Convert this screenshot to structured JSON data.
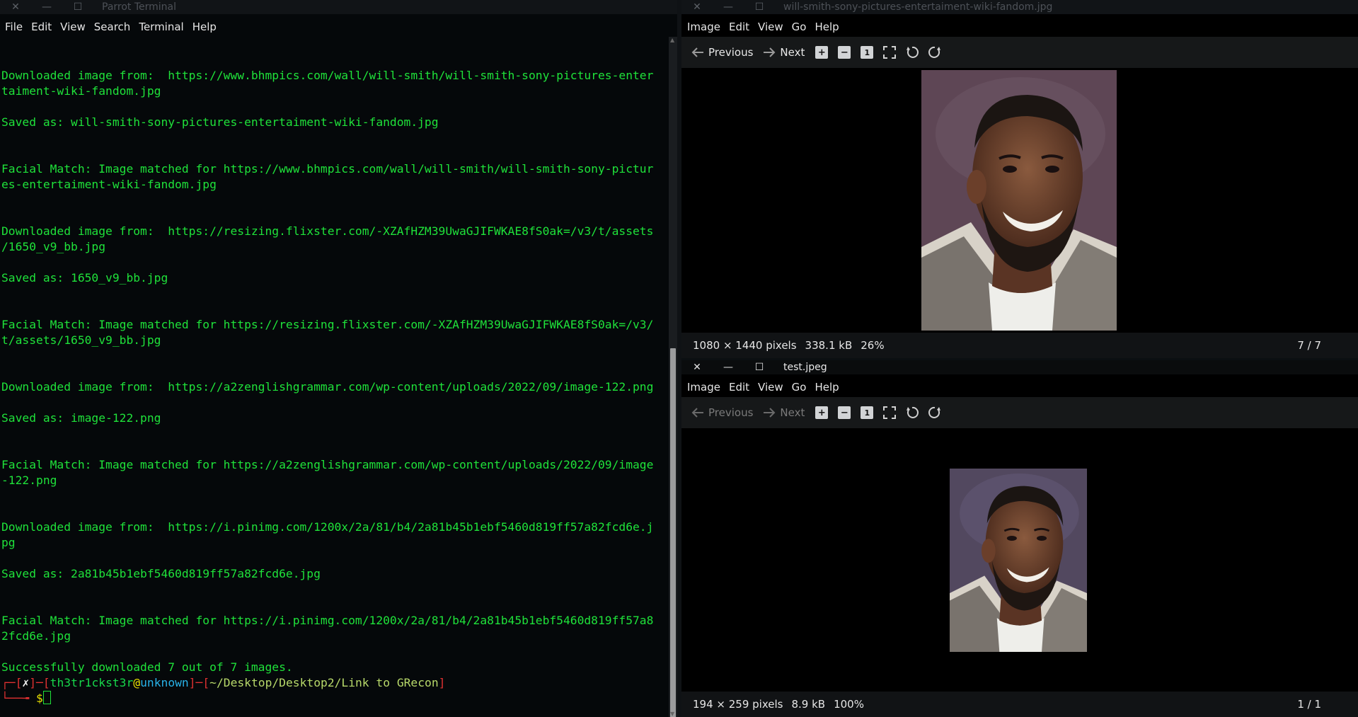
{
  "terminal": {
    "title": "Parrot Terminal",
    "menu": [
      "File",
      "Edit",
      "View",
      "Search",
      "Terminal",
      "Help"
    ],
    "lines": [
      "Downloaded image from:  https://www.bhmpics.com/wall/will-smith/will-smith-sony-pictures-enter",
      "taiment-wiki-fandom.jpg",
      "",
      "Saved as: will-smith-sony-pictures-entertaiment-wiki-fandom.jpg",
      "",
      "",
      "Facial Match: Image matched for https://www.bhmpics.com/wall/will-smith/will-smith-sony-pictur",
      "es-entertaiment-wiki-fandom.jpg",
      "",
      "",
      "Downloaded image from:  https://resizing.flixster.com/-XZAfHZM39UwaGJIFWKAE8fS0ak=/v3/t/assets",
      "/1650_v9_bb.jpg",
      "",
      "Saved as: 1650_v9_bb.jpg",
      "",
      "",
      "Facial Match: Image matched for https://resizing.flixster.com/-XZAfHZM39UwaGJIFWKAE8fS0ak=/v3/",
      "t/assets/1650_v9_bb.jpg",
      "",
      "",
      "Downloaded image from:  https://a2zenglishgrammar.com/wp-content/uploads/2022/09/image-122.png",
      "",
      "Saved as: image-122.png",
      "",
      "",
      "Facial Match: Image matched for https://a2zenglishgrammar.com/wp-content/uploads/2022/09/image",
      "-122.png",
      "",
      "",
      "Downloaded image from:  https://i.pinimg.com/1200x/2a/81/b4/2a81b45b1ebf5460d819ff57a82fcd6e.j",
      "pg",
      "",
      "Saved as: 2a81b45b1ebf5460d819ff57a82fcd6e.jpg",
      "",
      "",
      "Facial Match: Image matched for https://i.pinimg.com/1200x/2a/81/b4/2a81b45b1ebf5460d819ff57a8",
      "2fcd6e.jpg",
      "",
      "Successfully downloaded 7 out of 7 images."
    ],
    "prompt": {
      "open": "┌─[",
      "status": "✗",
      "sep1": "]─[",
      "user": "th3tr1ckst3r",
      "at": "@",
      "host": "unknown",
      "sep2": "]─[",
      "path": "~/Desktop/Desktop2/Link to GRecon",
      "close": "]",
      "line2": "└──╼ ",
      "symbol": "$"
    }
  },
  "viewer_top": {
    "title": "will-smith-sony-pictures-entertaiment-wiki-fandom.jpg",
    "menu": [
      "Image",
      "Edit",
      "View",
      "Go",
      "Help"
    ],
    "prev_label": "Previous",
    "next_label": "Next",
    "status": {
      "dimensions": "1080 × 1440 pixels",
      "size": "338.1 kB",
      "zoom": "26%",
      "count": "7 / 7"
    }
  },
  "viewer_bottom": {
    "title": "test.jpeg",
    "menu": [
      "Image",
      "Edit",
      "View",
      "Go",
      "Help"
    ],
    "prev_label": "Previous",
    "next_label": "Next",
    "status": {
      "dimensions": "194 × 259 pixels",
      "size": "8.9 kB",
      "zoom": "100%",
      "count": "1 / 1"
    }
  },
  "icons": {
    "close": "close-icon",
    "minimize": "minimize-icon",
    "maximize": "maximize-icon",
    "zoom_in": "zoom-in-icon",
    "zoom_out": "zoom-out-icon",
    "zoom_normal": "zoom-normal-icon",
    "fullscreen": "fullscreen-icon",
    "rotate_left": "rotate-left-icon",
    "rotate_right": "rotate-right-icon"
  }
}
